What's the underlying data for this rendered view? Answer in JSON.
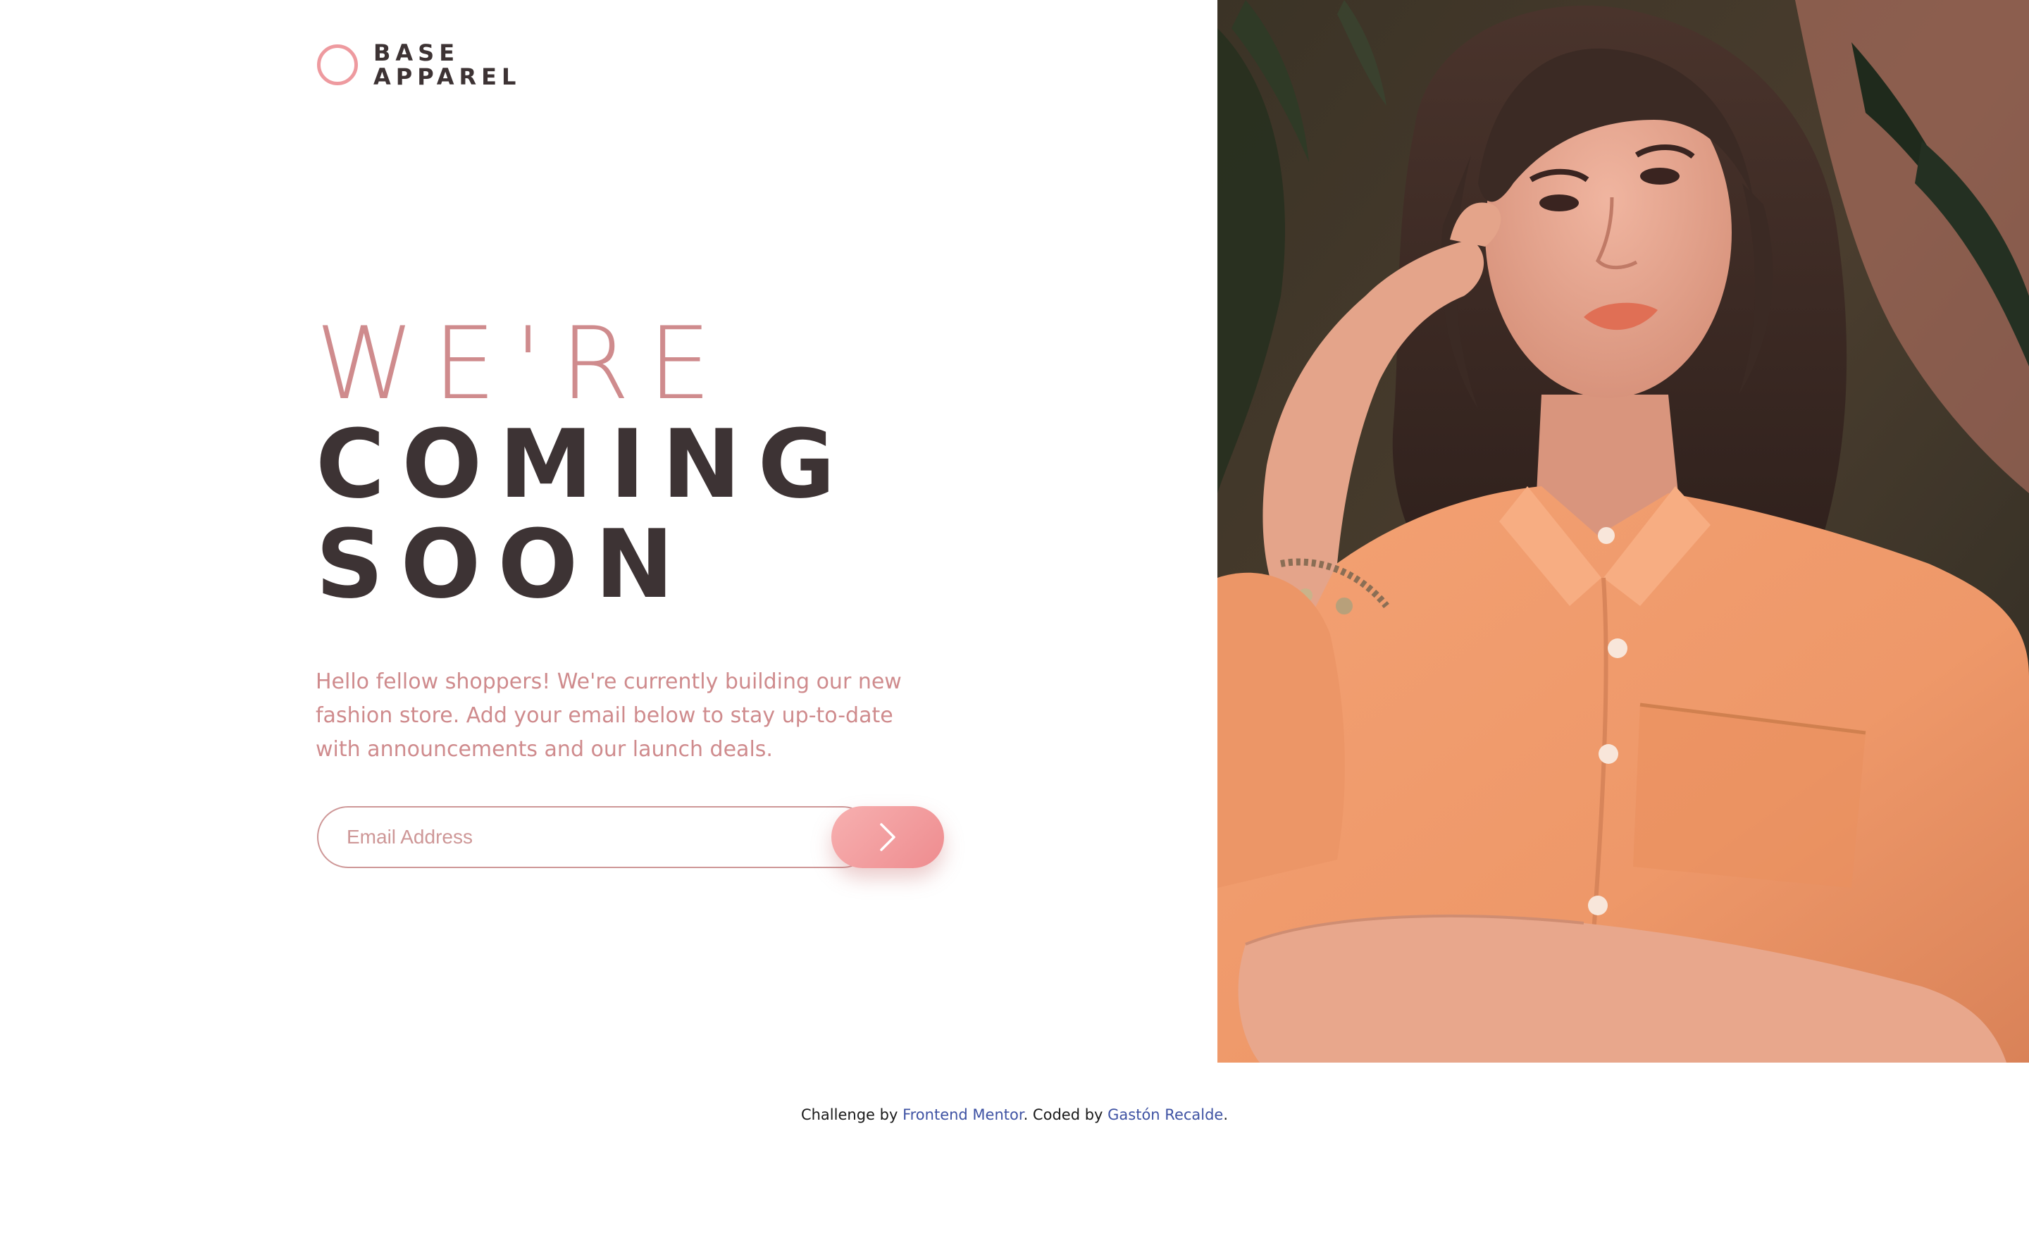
{
  "brand": {
    "line1": "BASE",
    "line2": "APPAREL",
    "accent_color": "#ee9a9f",
    "logo_icon": "circle-ring-icon"
  },
  "hero": {
    "headline_light": "WE'RE",
    "headline_dark_1": "COMING",
    "headline_dark_2": "SOON",
    "intro": "Hello fellow shoppers! We're currently building our new fashion store. Add your email below to stay up-to-date with announcements and our launch deals."
  },
  "form": {
    "email_placeholder": "Email Address",
    "email_value": "",
    "submit_icon": "chevron-right-icon"
  },
  "photo": {
    "alt": "Woman in an orange shirt"
  },
  "footer": {
    "prefix": "Challenge by",
    "challenge_link": "Frontend Mentor",
    "middle": ". Coded by",
    "author_link": "Gastón Recalde",
    "suffix": "."
  },
  "colors": {
    "text_dark": "#3d3334",
    "text_pink": "#cf8b8d",
    "link_blue": "#3e52a3",
    "button_gradient_start": "#f7b0b0",
    "button_gradient_end": "#ee8c8f"
  }
}
